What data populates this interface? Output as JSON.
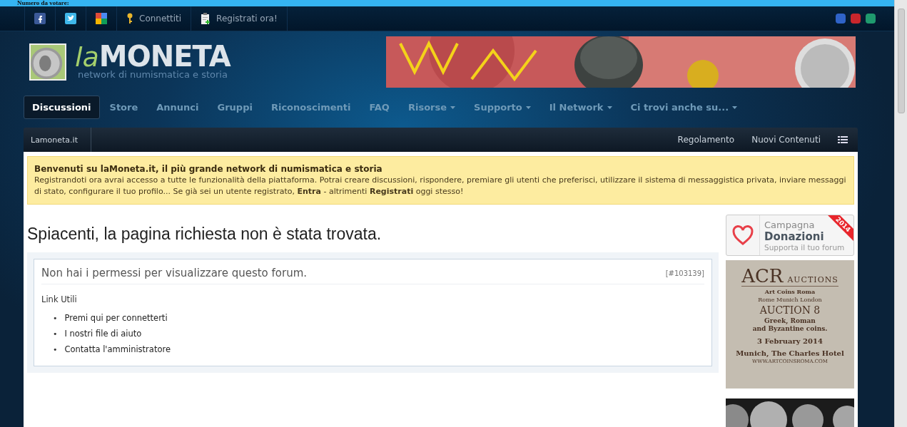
{
  "top_strip": {
    "text": "Numero da votare:"
  },
  "user_bar": {
    "social": [
      {
        "kind": "facebook"
      },
      {
        "kind": "twitter"
      },
      {
        "kind": "google"
      }
    ],
    "links": [
      {
        "kind": "key",
        "label": "Connettiti"
      },
      {
        "kind": "clipboard",
        "label": "Registrati ora!"
      }
    ],
    "themes": [
      {
        "color": "#2f63c8"
      },
      {
        "color": "#c8262c"
      },
      {
        "color": "#1f9a6e"
      }
    ]
  },
  "logo": {
    "prefix": "la",
    "name": "MONETA",
    "tagline": "network di numismatica e storia"
  },
  "nav": [
    {
      "label": "Discussioni",
      "selected": true,
      "dropdown": false
    },
    {
      "label": "Store",
      "selected": false,
      "dropdown": false
    },
    {
      "label": "Annunci",
      "selected": false,
      "dropdown": false
    },
    {
      "label": "Gruppi",
      "selected": false,
      "dropdown": false
    },
    {
      "label": "Riconoscimenti",
      "selected": false,
      "dropdown": false
    },
    {
      "label": "FAQ",
      "selected": false,
      "dropdown": false
    },
    {
      "label": "Risorse",
      "selected": false,
      "dropdown": true
    },
    {
      "label": "Supporto",
      "selected": false,
      "dropdown": true
    },
    {
      "label": "Il Network",
      "selected": false,
      "dropdown": true
    },
    {
      "label": "Ci trovi anche su...",
      "selected": false,
      "dropdown": true
    }
  ],
  "breadcrumb": {
    "items": [
      "Lamoneta.it"
    ],
    "links": [
      "Regolamento",
      "Nuovi Contenuti"
    ]
  },
  "notice": {
    "title": "Benvenuti su laMoneta.it, il più grande network di numismatica e storia",
    "text": "Registrandoti ora avrai accesso a tutte le funzionalità della piattaforma. Potrai creare discussioni, rispondere, premiare gli utenti che preferisci, utilizzare il sistema di messaggistica privata, inviare messaggi di stato, configurare il tuo profilo... Se già sei un utente registrato, **Entra** - altrimenti **Registrati** oggi stesso!"
  },
  "page_title": "Spiacenti, la pagina richiesta non è stata trovata.",
  "error_box": {
    "message": "Non hai i permessi per visualizzare questo forum.",
    "code": "[#103139]",
    "links_title": "Link Utili",
    "marker": "•",
    "links": [
      "Premi qui per connetterti",
      "I nostri file di aiuto",
      "Contatta l'amministratore"
    ]
  },
  "donation": {
    "line1": "Campagna",
    "line2": "Donazioni",
    "line3": "Supporta il tuo forum",
    "ribbon": "2014"
  },
  "acr_ad": {
    "title": "ACR",
    "title_suffix": "AUCTIONS",
    "subtitle": "Art Coins Roma",
    "cities": "Rome  Munich  London",
    "auction": "AUCTION 8",
    "desc": "Greek, Roman\nand Byzantine coins.",
    "date": "3 February 2014",
    "place": "Munich, The Charles Hotel",
    "url": "WWW.ARTCOINSROMA.COM"
  }
}
